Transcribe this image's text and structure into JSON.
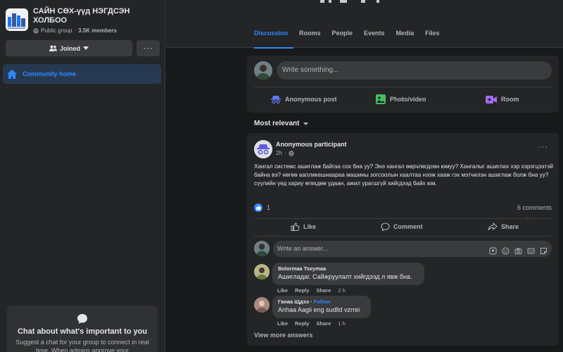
{
  "group": {
    "name": "САЙН СӨХ-үүд НЭГДСЭН ХОЛБОО",
    "privacy": "Public group",
    "separator": "·",
    "members": "3.5K members",
    "joined_label": "Joined",
    "more_label": "···"
  },
  "sidebar": {
    "community_home": "Community home",
    "chat_card": {
      "title": "Chat about what's important to you",
      "text": "Suggest a chat for your group to connect in real time. When admins approve your"
    }
  },
  "tabs": [
    {
      "label": "Discussion",
      "active": true
    },
    {
      "label": "Rooms",
      "active": false
    },
    {
      "label": "People",
      "active": false
    },
    {
      "label": "Events",
      "active": false
    },
    {
      "label": "Media",
      "active": false
    },
    {
      "label": "Files",
      "active": false
    }
  ],
  "composer": {
    "placeholder": "Write something...",
    "anonymous_label": "Anonymous post",
    "photo_label": "Photo/video",
    "room_label": "Room"
  },
  "feed": {
    "sort_label": "Most relevant"
  },
  "post": {
    "author": "Anonymous participant",
    "time": "2h",
    "time_sep": "·",
    "body": "Хангал системс ашиглаж байгаа сох бна уу? Энэ хангал өөрчлөгдсөн юмуу? Хангалыг ашиглах хэр хэрэгцээтэй байна вэ? нөгөө аапликешнаараа машины зогсоолын хаалтаа нээж хааж гэх мэтчилэн ашиглаж болж бна уу? сүүлийн үед хариу өгөхдөө удаан, ажил урагшгүй хийгдээд байх юм.",
    "reaction_count": "1",
    "comments_count": "6 comments",
    "like_label": "Like",
    "comment_label": "Comment",
    "share_label": "Share",
    "answer_placeholder": "Write an answer...",
    "view_more": "View more answers",
    "more_label": "···"
  },
  "comments": [
    {
      "name": "Bolormaa Tseymaa",
      "follow": "",
      "text": "Ашигладаг. Сайжруулалт хийгдээд л явж бна.",
      "like": "Like",
      "reply": "Reply",
      "share": "Share",
      "time": "2 h"
    },
    {
      "name": "Ганаа Щдээ",
      "follow": "Follow",
      "follow_sep": "·",
      "text": "Anhaa Aagii eng sudlld vzrrei",
      "like": "Like",
      "reply": "Reply",
      "share": "Share",
      "time": "1 h"
    }
  ],
  "colors": {
    "accent": "#2d88ff",
    "background": "#18191a",
    "surface": "#242526",
    "input": "#3a3b3c"
  }
}
